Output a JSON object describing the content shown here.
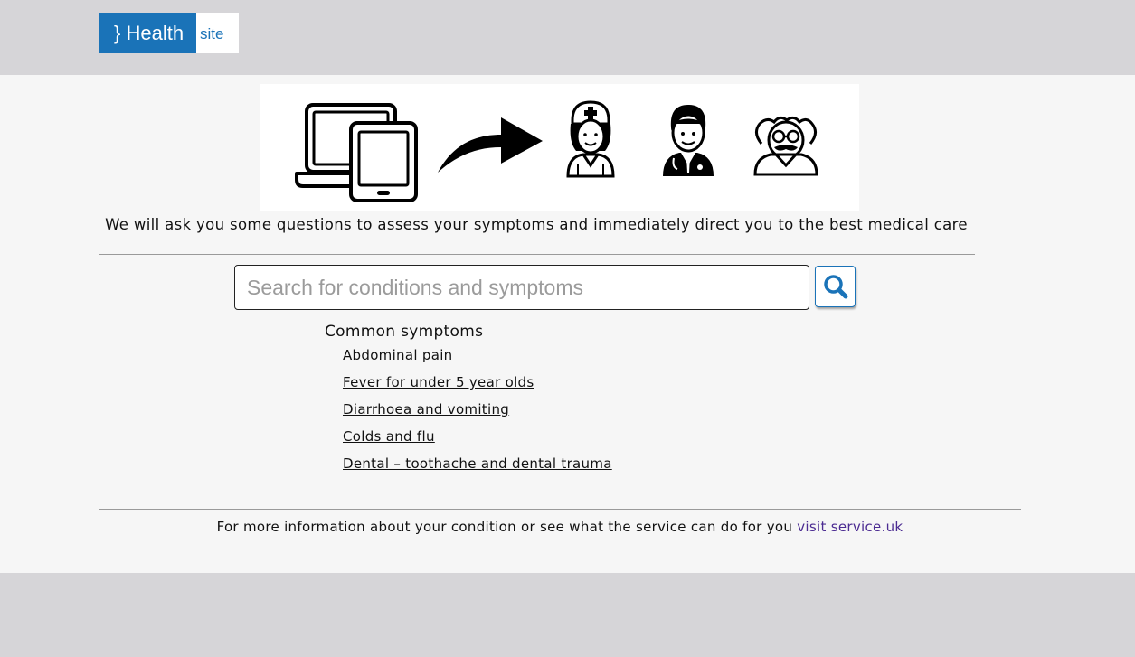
{
  "logo": {
    "brand": "} Health",
    "suffix": "site"
  },
  "banner": {
    "icons": [
      "devices-icon",
      "arrow-icon",
      "nurse-icon",
      "doctor-icon",
      "elderly-doctor-icon"
    ]
  },
  "intro_text": "We will ask you some questions to assess your symptoms and immediately direct you to the best medical care",
  "search": {
    "placeholder": "Search for conditions and symptoms",
    "value": "",
    "button_icon": "search-icon"
  },
  "common_symptoms": {
    "heading": "Common symptoms",
    "items": [
      {
        "label": "Abdominal pain"
      },
      {
        "label": "Fever for under 5 year olds"
      },
      {
        "label": "Diarrhoea and vomiting"
      },
      {
        "label": "Colds and flu"
      },
      {
        "label": "Dental – toothache and dental trauma"
      }
    ]
  },
  "footer": {
    "text": "For more information about your condition or see what the service can do for you ",
    "link_label": "visit service.uk"
  },
  "colors": {
    "brand_blue": "#1a73b8",
    "link_purple": "#4c2c92",
    "page_gray": "#d6d5d8",
    "panel_bg": "#f6f6f6"
  }
}
